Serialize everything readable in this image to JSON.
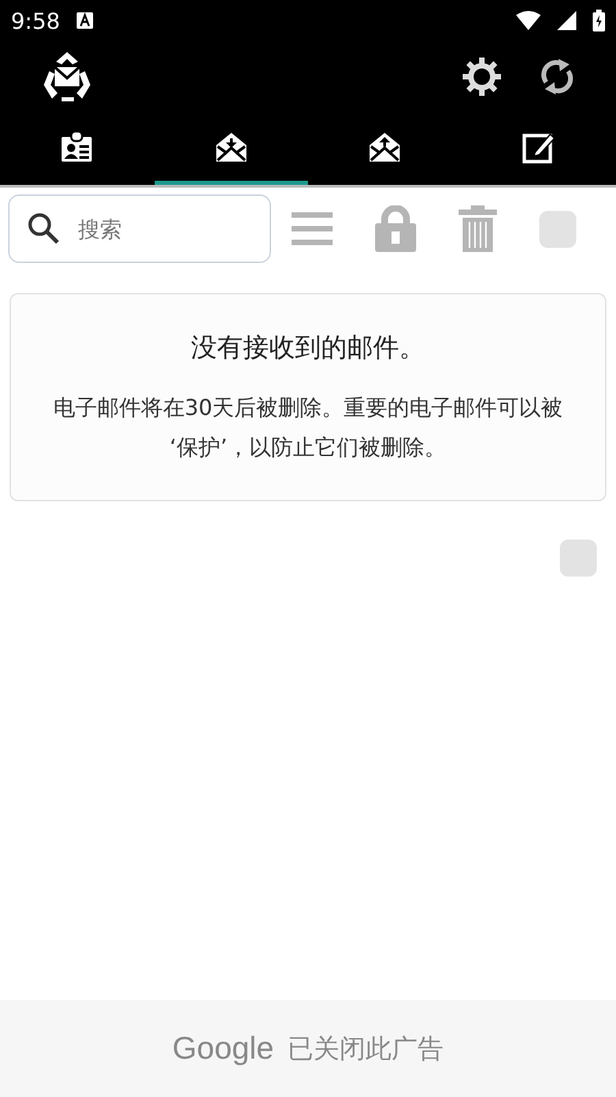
{
  "status_bar": {
    "time": "9:58"
  },
  "tabs": [
    {
      "kind": "contact",
      "selected": false
    },
    {
      "kind": "inbox",
      "selected": true
    },
    {
      "kind": "sent",
      "selected": false
    },
    {
      "kind": "compose",
      "selected": false
    }
  ],
  "toolbar": {
    "search": {
      "placeholder": "搜索"
    },
    "select_all": {
      "checked": false
    }
  },
  "empty_card": {
    "title": "没有接收到的邮件。",
    "message": "电子邮件将在30天后被删除。重要的电子邮件可以被 ‘保护’，以防止它们被删除。"
  },
  "list_checkbox": {
    "checked": false
  },
  "ad_bar": {
    "brand": "Google",
    "text": "已关闭此广告"
  }
}
